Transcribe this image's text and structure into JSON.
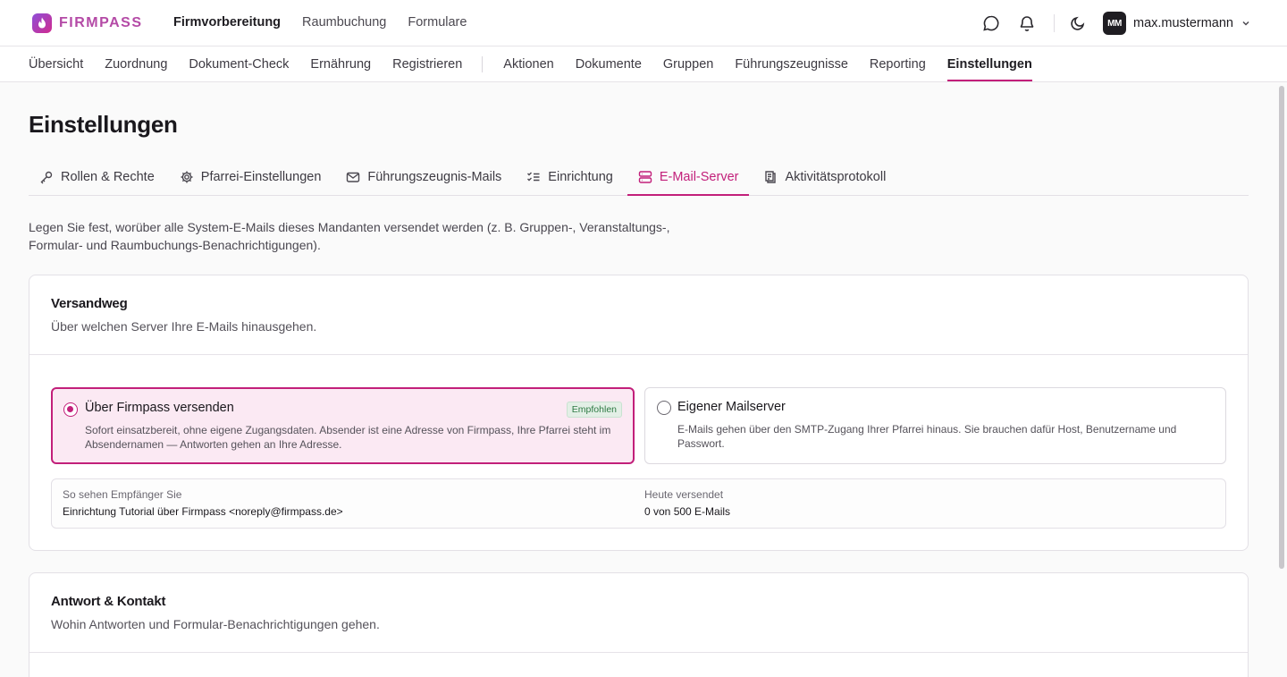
{
  "brand": {
    "name": "FIRMPASS"
  },
  "main_nav": [
    {
      "label": "Firmvorbereitung",
      "active": true
    },
    {
      "label": "Raumbuchung",
      "active": false
    },
    {
      "label": "Formulare",
      "active": false
    }
  ],
  "user": {
    "initials": "MM",
    "name": "max.mustermann"
  },
  "sub_nav": {
    "left": [
      "Übersicht",
      "Zuordnung",
      "Dokument-Check",
      "Ernährung",
      "Registrieren"
    ],
    "right": [
      "Aktionen",
      "Dokumente",
      "Gruppen",
      "Führungszeugnisse",
      "Reporting",
      "Einstellungen"
    ],
    "active": "Einstellungen"
  },
  "page": {
    "title": "Einstellungen",
    "tabs": [
      {
        "label": "Rollen & Rechte",
        "icon": "key-icon"
      },
      {
        "label": "Pfarrei-Einstellungen",
        "icon": "gear-icon"
      },
      {
        "label": "Führungszeugnis-Mails",
        "icon": "mail-icon"
      },
      {
        "label": "Einrichtung",
        "icon": "checklist-icon"
      },
      {
        "label": "E-Mail-Server",
        "icon": "server-icon",
        "active": true
      },
      {
        "label": "Aktivitätsprotokoll",
        "icon": "log-icon"
      }
    ],
    "intro": "Legen Sie fest, worüber alle System-E-Mails dieses Mandanten versendet werden (z. B. Gruppen-, Veranstaltungs-, Formular- und Raumbuchungs-Benachrichtigungen)."
  },
  "versandweg": {
    "title": "Versandweg",
    "subtitle": "Über welchen Server Ihre E-Mails hinausgehen.",
    "options": [
      {
        "title": "Über Firmpass versenden",
        "badge": "Empfohlen",
        "description": "Sofort einsatzbereit, ohne eigene Zugangsdaten. Absender ist eine Adresse von Firmpass, Ihre Pfarrei steht im Absendernamen — Antworten gehen an Ihre Adresse.",
        "selected": true
      },
      {
        "title": "Eigener Mailserver",
        "description": "E-Mails gehen über den SMTP-Zugang Ihrer Pfarrei hinaus. Sie brauchen dafür Host, Benutzername und Passwort.",
        "selected": false
      }
    ],
    "preview": {
      "sender_label": "So sehen Empfänger Sie",
      "sender_value": "Einrichtung Tutorial über Firmpass <noreply@firmpass.de>",
      "sent_label": "Heute versendet",
      "sent_value": "0 von 500 E-Mails"
    }
  },
  "antwort": {
    "title": "Antwort & Kontakt",
    "subtitle": "Wohin Antworten und Formular-Benachrichtigungen gehen."
  },
  "colors": {
    "accent": "#c21f7a",
    "accent_bg": "#fbe9f3",
    "badge_green": "#2e7a44"
  }
}
